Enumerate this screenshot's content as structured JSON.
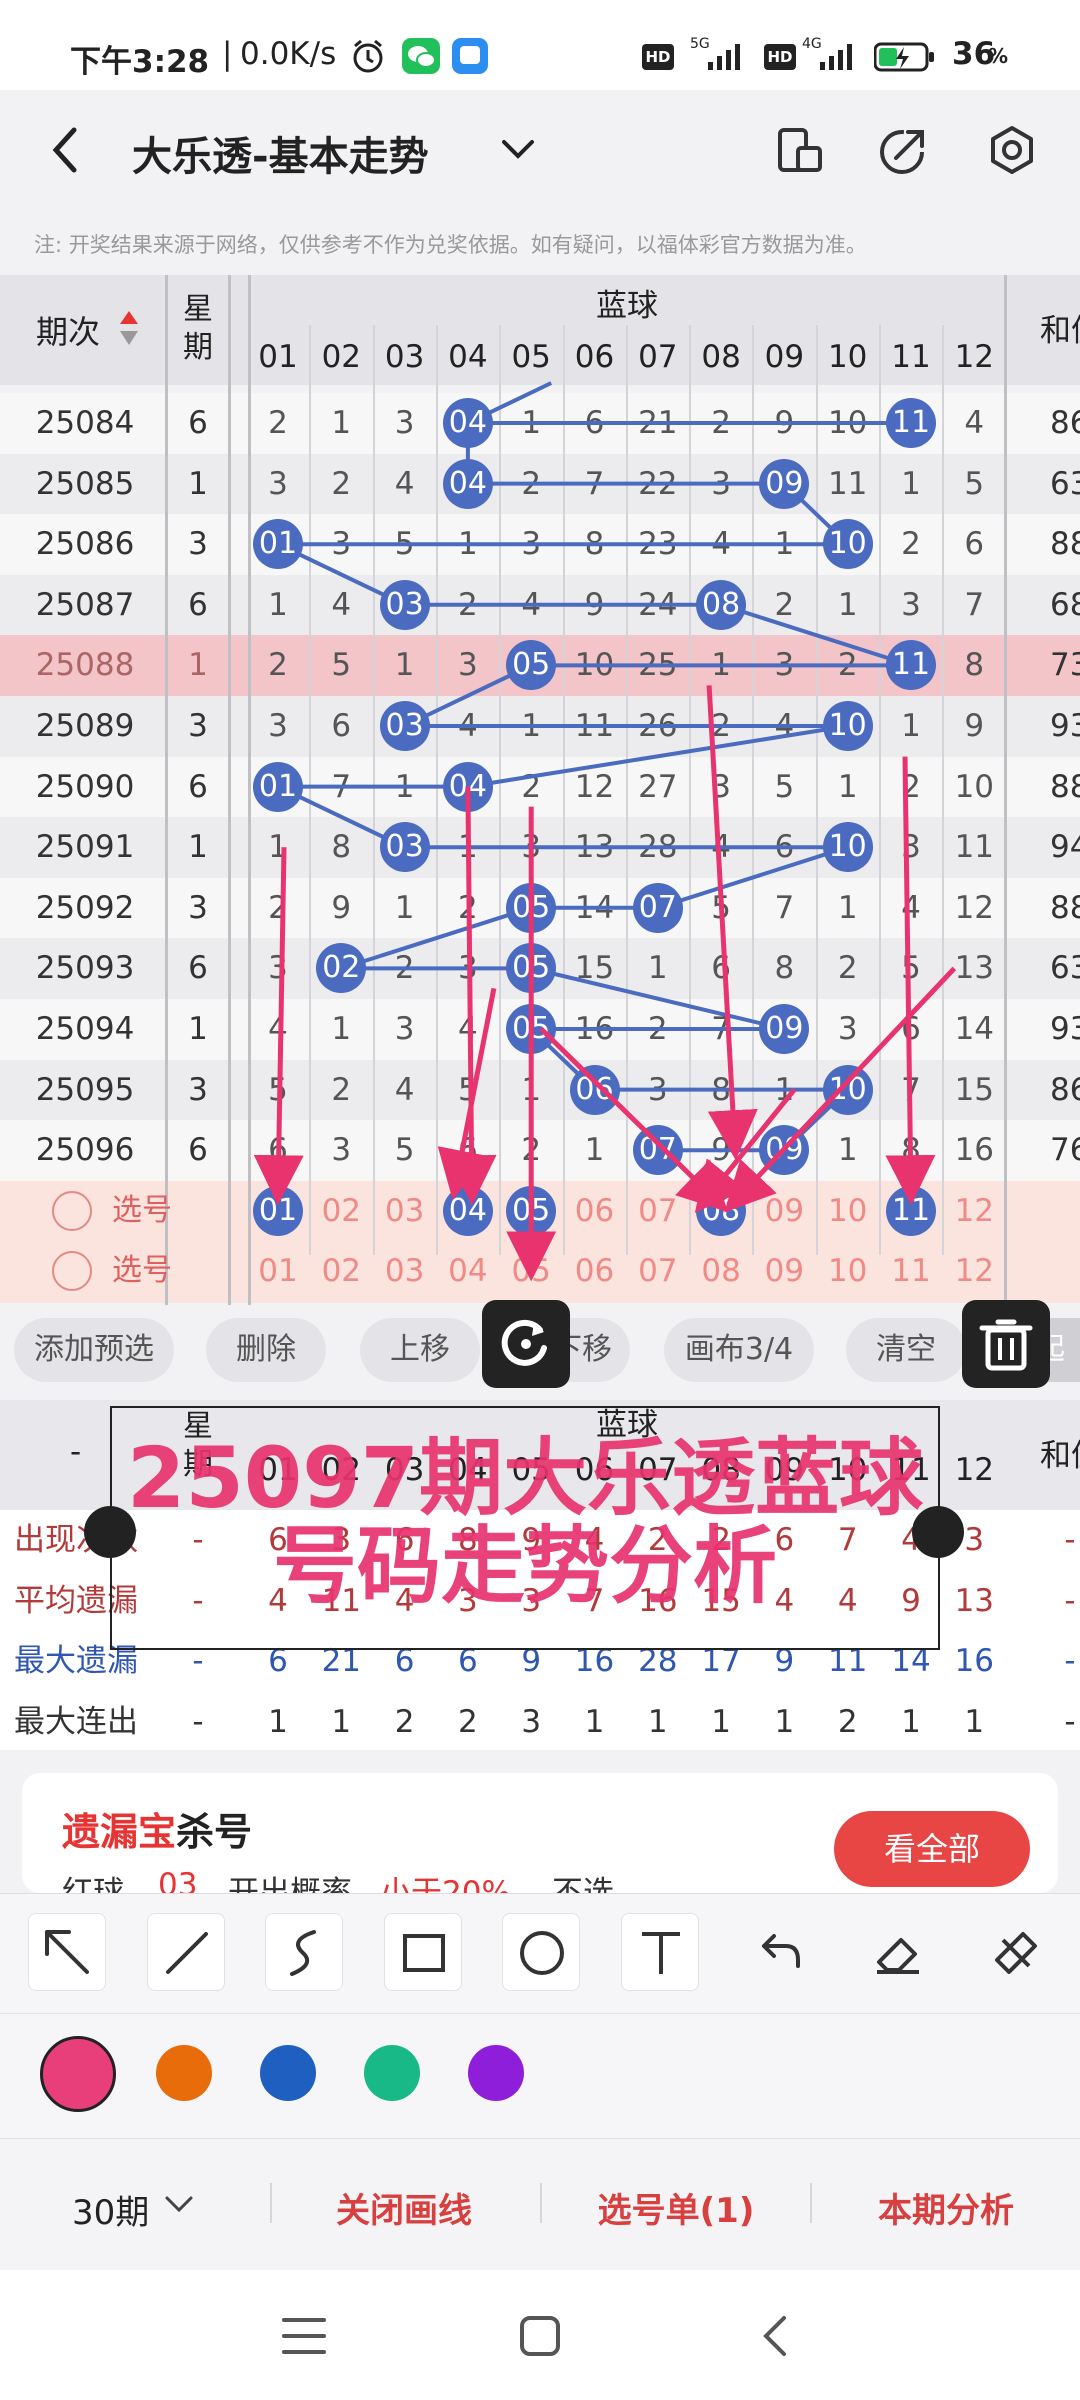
{
  "status": {
    "time": "下午3:28",
    "speed": "0.0K/s",
    "battery": "36",
    "battery_unit": "%",
    "sig1": "5G",
    "sig2": "4G",
    "hd1": "HD",
    "hd2": "HD"
  },
  "app": {
    "title": "大乐透-基本走势",
    "notice": "注: 开奖结果来源于网络，仅供参考不作为兑奖依据。如有疑问，以福体彩官方数据为准。"
  },
  "table": {
    "col_period": "期次",
    "col_week": "星期",
    "col_blue": "蓝球",
    "col_sum": "和值",
    "numbers": [
      "01",
      "02",
      "03",
      "04",
      "05",
      "06",
      "07",
      "08",
      "09",
      "10",
      "11",
      "12"
    ],
    "rows": [
      {
        "period": "25084",
        "week": "6",
        "cells": [
          "2",
          "1",
          "3",
          "04",
          "1",
          "6",
          "21",
          "2",
          "9",
          "10",
          "11",
          "4"
        ],
        "balls": [
          3,
          10
        ],
        "sum": "86"
      },
      {
        "period": "25085",
        "week": "1",
        "cells": [
          "3",
          "2",
          "4",
          "04",
          "2",
          "7",
          "22",
          "3",
          "09",
          "11",
          "1",
          "5"
        ],
        "balls": [
          3,
          8
        ],
        "sum": "63"
      },
      {
        "period": "25086",
        "week": "3",
        "cells": [
          "01",
          "3",
          "5",
          "1",
          "3",
          "8",
          "23",
          "4",
          "1",
          "10",
          "2",
          "6"
        ],
        "balls": [
          0,
          9
        ],
        "sum": "88"
      },
      {
        "period": "25087",
        "week": "6",
        "cells": [
          "1",
          "4",
          "03",
          "2",
          "4",
          "9",
          "24",
          "08",
          "2",
          "1",
          "3",
          "7"
        ],
        "balls": [
          2,
          7
        ],
        "sum": "68"
      },
      {
        "period": "25088",
        "week": "1",
        "cells": [
          "2",
          "5",
          "1",
          "3",
          "05",
          "10",
          "25",
          "1",
          "3",
          "2",
          "11",
          "8"
        ],
        "balls": [
          4,
          10
        ],
        "sum": "73"
      },
      {
        "period": "25089",
        "week": "3",
        "cells": [
          "3",
          "6",
          "03",
          "4",
          "1",
          "11",
          "26",
          "2",
          "4",
          "10",
          "1",
          "9"
        ],
        "balls": [
          2,
          9
        ],
        "sum": "93"
      },
      {
        "period": "25090",
        "week": "6",
        "cells": [
          "01",
          "7",
          "1",
          "04",
          "2",
          "12",
          "27",
          "3",
          "5",
          "1",
          "2",
          "10"
        ],
        "balls": [
          0,
          3
        ],
        "sum": "88"
      },
      {
        "period": "25091",
        "week": "1",
        "cells": [
          "1",
          "8",
          "03",
          "1",
          "3",
          "13",
          "28",
          "4",
          "6",
          "10",
          "3",
          "11"
        ],
        "balls": [
          2,
          9
        ],
        "sum": "94"
      },
      {
        "period": "25092",
        "week": "3",
        "cells": [
          "2",
          "9",
          "1",
          "2",
          "05",
          "14",
          "07",
          "5",
          "7",
          "1",
          "4",
          "12"
        ],
        "balls": [
          4,
          6
        ],
        "sum": "88"
      },
      {
        "period": "25093",
        "week": "6",
        "cells": [
          "3",
          "02",
          "2",
          "3",
          "05",
          "15",
          "1",
          "6",
          "8",
          "2",
          "5",
          "13"
        ],
        "balls": [
          1,
          4
        ],
        "sum": "63"
      },
      {
        "period": "25094",
        "week": "1",
        "cells": [
          "4",
          "1",
          "3",
          "4",
          "05",
          "16",
          "2",
          "7",
          "09",
          "3",
          "6",
          "14"
        ],
        "balls": [
          4,
          8
        ],
        "sum": "93"
      },
      {
        "period": "25095",
        "week": "3",
        "cells": [
          "5",
          "2",
          "4",
          "5",
          "1",
          "06",
          "3",
          "8",
          "1",
          "10",
          "7",
          "15"
        ],
        "balls": [
          5,
          9
        ],
        "sum": "86"
      },
      {
        "period": "25096",
        "week": "6",
        "cells": [
          "6",
          "3",
          "5",
          "6",
          "2",
          "1",
          "07",
          "9",
          "09",
          "1",
          "8",
          "16"
        ],
        "balls": [
          6,
          8
        ],
        "sum": "76"
      }
    ],
    "pick_label": "选号",
    "pick1_selected": [
      0,
      3,
      4,
      7,
      10
    ]
  },
  "actions": {
    "add": "添加预选",
    "delete": "删除",
    "up": "上移",
    "down": "下移",
    "canvas": "画布3/4",
    "clear": "清空",
    "edge": "起"
  },
  "stats": {
    "dash": "-",
    "rows": [
      {
        "label": "出现次数",
        "values": [
          "6",
          "3",
          "6",
          "8",
          "9",
          "4",
          "2",
          "2",
          "6",
          "7",
          "4",
          "3"
        ],
        "color": "#b23a3a"
      },
      {
        "label": "平均遗漏",
        "values": [
          "4",
          "11",
          "4",
          "3",
          "3",
          "7",
          "16",
          "15",
          "4",
          "4",
          "9",
          "13"
        ],
        "color": "#b23a3a"
      },
      {
        "label": "最大遗漏",
        "values": [
          "6",
          "21",
          "6",
          "6",
          "9",
          "16",
          "28",
          "17",
          "9",
          "11",
          "14",
          "16"
        ],
        "color": "#2f56b0"
      },
      {
        "label": "最大连出",
        "values": [
          "1",
          "1",
          "2",
          "2",
          "3",
          "1",
          "1",
          "1",
          "1",
          "2",
          "1",
          "1"
        ],
        "color": "#333333"
      }
    ]
  },
  "overlay_text": [
    "25097期大乐透蓝球",
    "号码走势分析"
  ],
  "kill": {
    "brand_a": "遗漏宝",
    "brand_b": "杀号",
    "line": [
      "红球",
      "03",
      "开出概率",
      "小于20%",
      "不选"
    ],
    "button": "看全部"
  },
  "draw_tools": [
    "arrow-tool-icon",
    "line-tool-icon",
    "freehand-tool-icon",
    "rectangle-tool-icon",
    "circle-tool-icon",
    "text-tool-icon",
    "undo-icon",
    "eraser-icon",
    "clear-all-icon"
  ],
  "palette": [
    "#e83e7a",
    "#e86c0a",
    "#1f5fbf",
    "#19b887",
    "#8e1ed9"
  ],
  "bottom": {
    "periods": "30期",
    "close_lines": "关闭画线",
    "pick_list": "选号单(1)",
    "analysis": "本期分析"
  },
  "colors": {
    "ball": "#4a6bbf",
    "line": "#4a6bbf",
    "pink": "#e8336f",
    "highlight_row": "#f3c5c8"
  }
}
